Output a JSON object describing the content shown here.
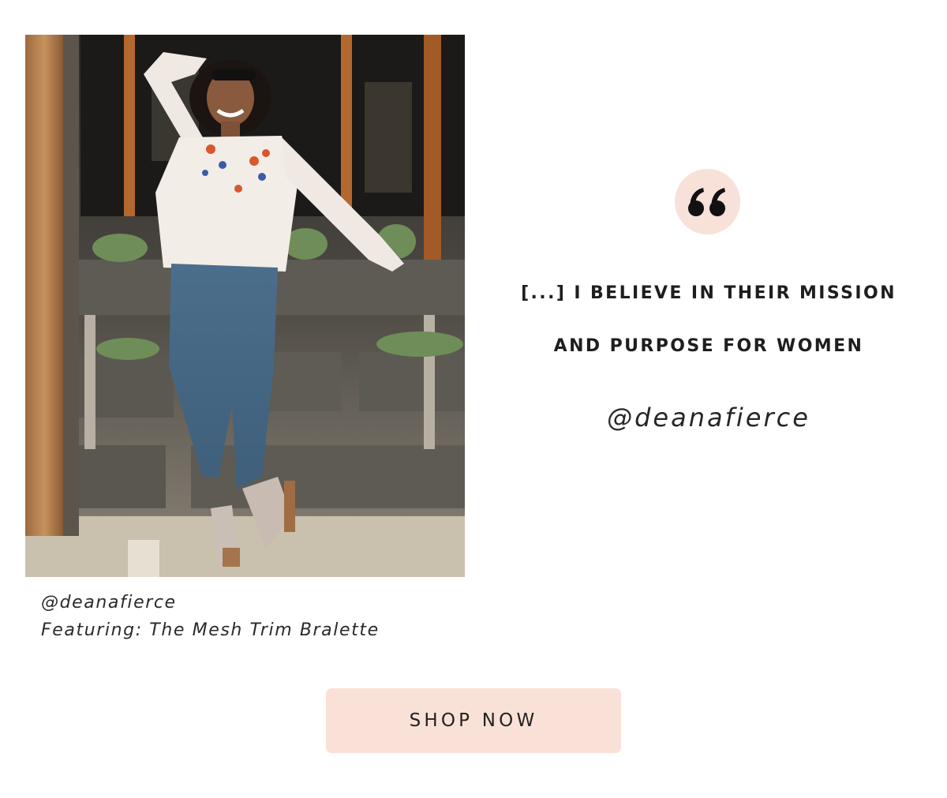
{
  "photo": {
    "alt": "Woman in embroidered sheer blouse, jeans and wedge sandals posing in front of wooden planters"
  },
  "caption": {
    "handle": "@deanafierce",
    "featuring": "Featuring: The Mesh Trim Bralette"
  },
  "quote": {
    "icon": "quote-open-icon",
    "line1": "[...] I BELIEVE IN THEIR MISSION",
    "line2": "AND PURPOSE FOR WOMEN",
    "author": "@deanafierce"
  },
  "cta": {
    "label": "SHOP NOW"
  },
  "colors": {
    "accent": "#fae1d8",
    "badge": "#f7e1d8",
    "text": "#1e1e1e"
  }
}
